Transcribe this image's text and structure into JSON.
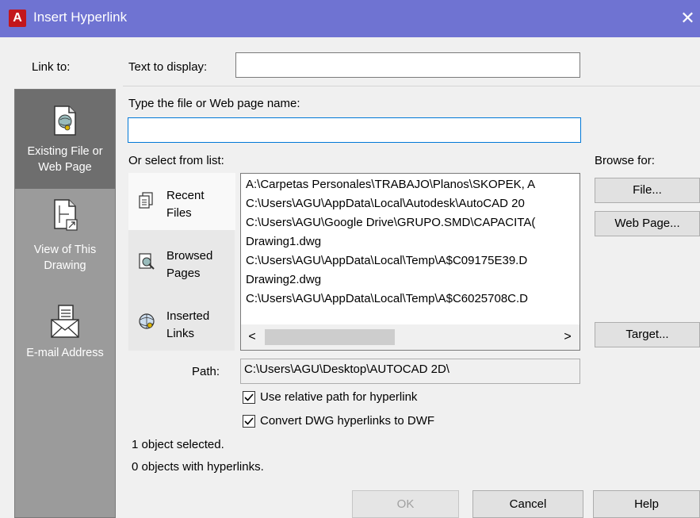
{
  "window": {
    "title": "Insert Hyperlink",
    "app_icon_letter": "A",
    "close_glyph": "✕"
  },
  "link_to": {
    "label": "Link to:",
    "items": [
      {
        "label_line1": "Existing File or",
        "label_line2": "Web Page",
        "icon": "file-globe-icon",
        "selected": true
      },
      {
        "label_line1": "View of This",
        "label_line2": "Drawing",
        "icon": "drawing-view-icon",
        "selected": false
      },
      {
        "label_line1": "E-mail Address",
        "label_line2": "",
        "icon": "email-icon",
        "selected": false
      }
    ]
  },
  "text_to_display": {
    "label": "Text to display:",
    "value": ""
  },
  "file_name": {
    "label": "Type the file or Web page name:",
    "value": ""
  },
  "select_list": {
    "label": "Or select from list:",
    "tabs": [
      {
        "line1": "Recent",
        "line2": "Files",
        "icon": "recent-files-icon",
        "selected": true
      },
      {
        "line1": "Browsed",
        "line2": "Pages",
        "icon": "browsed-pages-icon",
        "selected": false
      },
      {
        "line1": "Inserted",
        "line2": "Links",
        "icon": "inserted-links-icon",
        "selected": false
      }
    ],
    "items": [
      "A:\\Carpetas Personales\\TRABAJO\\Planos\\SKOPEK, A",
      "C:\\Users\\AGU\\AppData\\Local\\Autodesk\\AutoCAD 20",
      "C:\\Users\\AGU\\Google Drive\\GRUPO.SMD\\CAPACITA(",
      "Drawing1.dwg",
      "C:\\Users\\AGU\\AppData\\Local\\Temp\\A$C09175E39.D",
      "Drawing2.dwg",
      "C:\\Users\\AGU\\AppData\\Local\\Temp\\A$C6025708C.D"
    ],
    "scroll_left": "<",
    "scroll_right": ">"
  },
  "browse": {
    "label": "Browse for:",
    "file_button": "File...",
    "webpage_button": "Web Page...",
    "target_button": "Target..."
  },
  "path": {
    "label": "Path:",
    "value": "C:\\Users\\AGU\\Desktop\\AUTOCAD 2D\\"
  },
  "options": {
    "relative_path": {
      "label": "Use relative path for hyperlink",
      "checked": true
    },
    "convert_dwg": {
      "label": "Convert DWG hyperlinks to DWF",
      "checked": true
    }
  },
  "status": {
    "selected": "1 object selected.",
    "with_links": "0 objects with hyperlinks."
  },
  "footer": {
    "ok": "OK",
    "cancel": "Cancel",
    "help": "Help"
  }
}
